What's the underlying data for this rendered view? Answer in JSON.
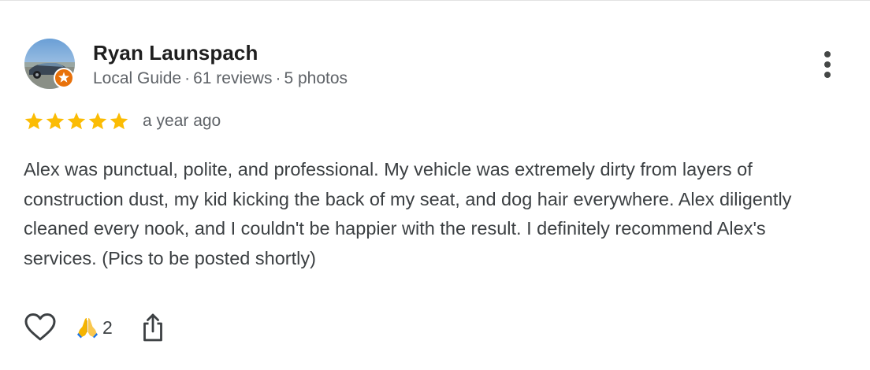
{
  "review": {
    "author": {
      "name": "Ryan Launspach",
      "guide_label": "Local Guide",
      "reviews": "61 reviews",
      "photos": "5 photos",
      "separator": "·"
    },
    "rating": 5,
    "rating_max": 5,
    "date": "a year ago",
    "text": "Alex was punctual, polite, and professional. My vehicle was extremely dirty from layers of construction dust, my kid kicking the back of my seat, and dog hair everywhere. Alex diligently cleaned every nook, and I couldn't be happier with the result. I definitely recommend Alex's services. (Pics to be posted shortly)",
    "reactions": {
      "pray_count": "2"
    }
  },
  "icons": {
    "more": "more-vert-icon",
    "star": "star-icon",
    "like": "heart-outline-icon",
    "reaction": "folded-hands-icon",
    "share": "share-icon",
    "badge": "local-guide-badge-icon"
  },
  "colors": {
    "star": "#fbbc04",
    "badge": "#e8710a",
    "name": "#1f1f1f",
    "meta": "#5f6368",
    "body": "#3c4043"
  }
}
